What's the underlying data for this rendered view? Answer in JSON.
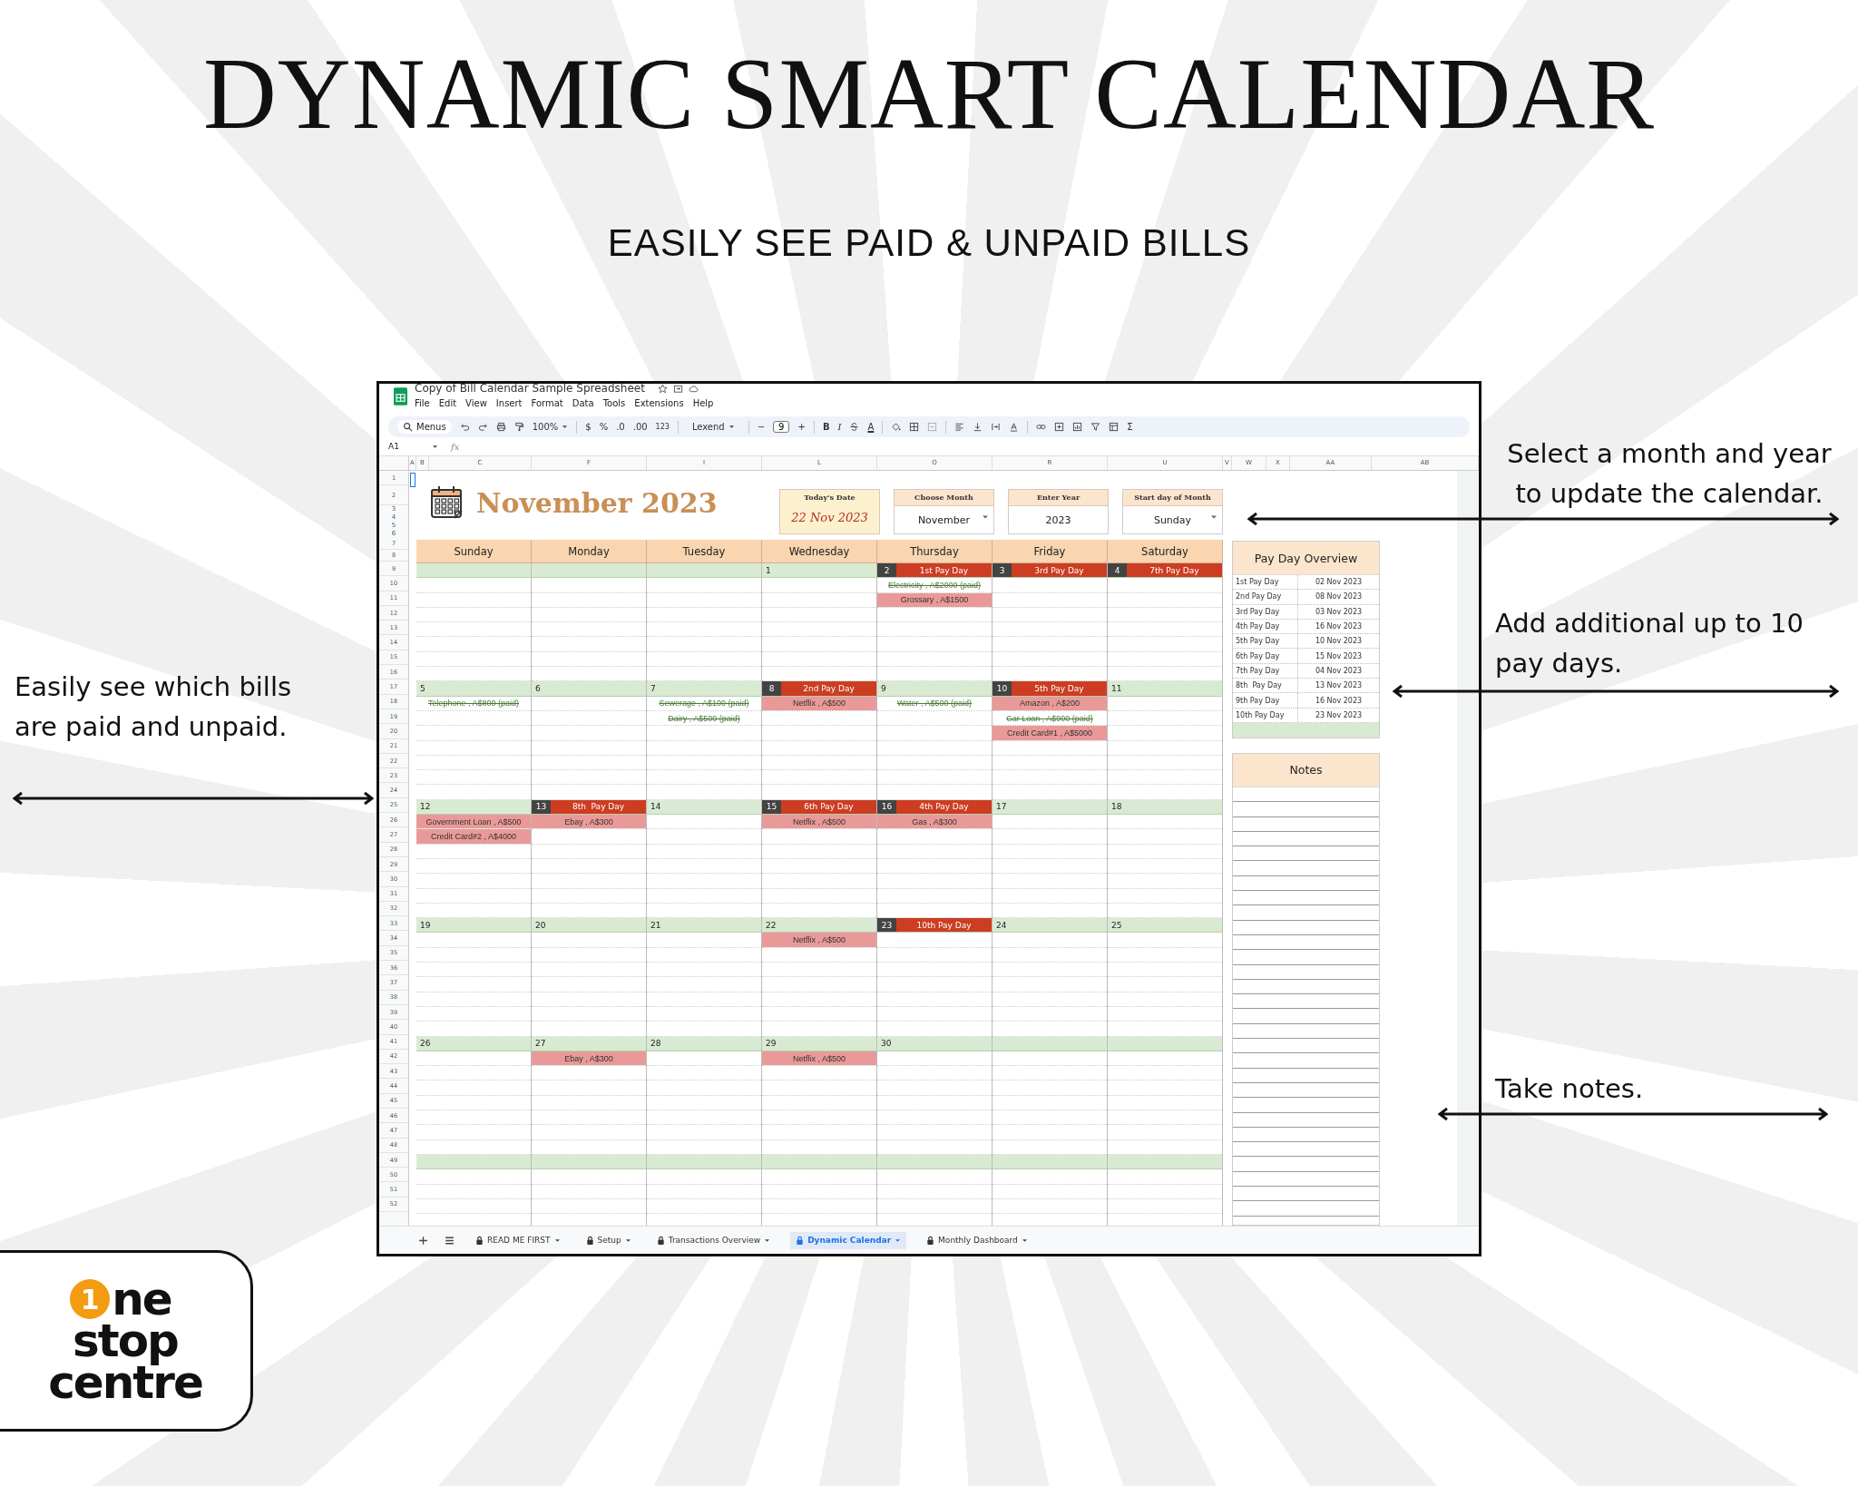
{
  "title": "DYNAMIC SMART CALENDAR",
  "subtitle": "EASILY SEE PAID & UNPAID BILLS",
  "annotations": [
    "Select a month and year to update the calendar.",
    "Add additional up to 10 pay days.",
    "Easily see which bills are paid and unpaid.",
    "Take notes."
  ],
  "sheet": {
    "doc_title": "Copy of Bill Calendar Sample Spreadsheet",
    "menus": [
      "File",
      "Edit",
      "View",
      "Insert",
      "Format",
      "Data",
      "Tools",
      "Extensions",
      "Help"
    ],
    "toolbar": {
      "search": "Menus",
      "zoom": "100%",
      "currency": "$",
      "percent": "%",
      "decrease_decimals": ".0",
      "increase_decimals": ".00",
      "number_format": "123",
      "font": "Lexend",
      "decrease_size": "−",
      "font_size": "9",
      "increase_size": "+",
      "bold": "B",
      "italic": "I",
      "text_color": "A",
      "functions": "Σ"
    },
    "cell_ref": "A1",
    "fx": "fx",
    "columns": [
      "A",
      "B",
      "C",
      "F",
      "I",
      "L",
      "O",
      "R",
      "U",
      "V",
      "W",
      "X",
      "AA",
      "AB"
    ],
    "row_numbers": [
      "1",
      "2",
      "3",
      "4",
      "5",
      "6",
      "7",
      "8",
      "9",
      "10",
      "11",
      "12",
      "13",
      "14",
      "15",
      "16",
      "17",
      "18",
      "19",
      "20",
      "21",
      "22",
      "23",
      "24",
      "25",
      "26",
      "27",
      "28",
      "29",
      "30",
      "31",
      "32",
      "33",
      "34",
      "35",
      "36",
      "37",
      "38",
      "39",
      "40",
      "41",
      "42",
      "43",
      "44",
      "45",
      "46",
      "47",
      "48",
      "49",
      "50",
      "51",
      "52"
    ],
    "month_title": "November 2023",
    "controls": [
      {
        "label": "Today's Date",
        "value": "22 Nov 2023",
        "kind": "date"
      },
      {
        "label": "Choose Month",
        "value": "November",
        "kind": "dropdown"
      },
      {
        "label": "Enter Year",
        "value": "2023",
        "kind": "input"
      },
      {
        "label": "Start day of Month",
        "value": "Sunday",
        "kind": "dropdown"
      }
    ],
    "weekdays": [
      "Sunday",
      "Monday",
      "Tuesday",
      "Wednesday",
      "Thursday",
      "Friday",
      "Saturday"
    ],
    "weeks": [
      [
        {
          "kind": "blank"
        },
        {
          "kind": "blank"
        },
        {
          "kind": "blank"
        },
        {
          "date": "1"
        },
        {
          "date": "2",
          "payday": "1st Pay Day",
          "entries": [
            {
              "text": "Electricity , A$2000 (paid)",
              "paid": true
            },
            {
              "text": "Grossary , A$1500",
              "paid": false
            }
          ]
        },
        {
          "date": "3",
          "payday": "3rd Pay Day"
        },
        {
          "date": "4",
          "payday": "7th Pay Day"
        }
      ],
      [
        {
          "date": "5",
          "entries": [
            {
              "text": "Telephone , A$800 (paid)",
              "paid": true
            }
          ]
        },
        {
          "date": "6"
        },
        {
          "date": "7",
          "entries": [
            {
              "text": "Sewerage , A$100 (paid)",
              "paid": true
            },
            {
              "text": "Dairy , A$500 (paid)",
              "paid": true
            }
          ]
        },
        {
          "date": "8",
          "payday": "2nd Pay Day",
          "entries": [
            {
              "text": "Netflix , A$500",
              "paid": false
            }
          ]
        },
        {
          "date": "9",
          "entries": [
            {
              "text": "Water , A$500 (paid)",
              "paid": true
            }
          ]
        },
        {
          "date": "10",
          "payday": "5th Pay Day",
          "entries": [
            {
              "text": "Amazon , A$200",
              "paid": false
            },
            {
              "text": "Car Loan , A$900 (paid)",
              "paid": true
            },
            {
              "text": "Credit Card#1 , A$5000",
              "paid": false
            }
          ]
        },
        {
          "date": "11"
        }
      ],
      [
        {
          "date": "12",
          "entries": [
            {
              "text": "Government Loan , A$500",
              "paid": false
            },
            {
              "text": "Credit Card#2 , A$4000",
              "paid": false
            }
          ]
        },
        {
          "date": "13",
          "payday": "8th  Pay Day",
          "entries": [
            {
              "text": "Ebay , A$300",
              "paid": false
            }
          ]
        },
        {
          "date": "14"
        },
        {
          "date": "15",
          "payday": "6th Pay Day",
          "entries": [
            {
              "text": "Netflix , A$500",
              "paid": false
            }
          ]
        },
        {
          "date": "16",
          "payday": "4th Pay Day",
          "entries": [
            {
              "text": "Gas , A$300",
              "paid": false
            }
          ]
        },
        {
          "date": "17"
        },
        {
          "date": "18"
        }
      ],
      [
        {
          "date": "19"
        },
        {
          "date": "20"
        },
        {
          "date": "21"
        },
        {
          "date": "22",
          "entries": [
            {
              "text": "Netflix , A$500",
              "paid": false
            }
          ]
        },
        {
          "date": "23",
          "payday": "10th Pay Day"
        },
        {
          "date": "24"
        },
        {
          "date": "25"
        }
      ],
      [
        {
          "date": "26"
        },
        {
          "date": "27",
          "entries": [
            {
              "text": "Ebay , A$300",
              "paid": false
            }
          ]
        },
        {
          "date": "28"
        },
        {
          "date": "29",
          "entries": [
            {
              "text": "Netflix , A$500",
              "paid": false
            }
          ]
        },
        {
          "date": "30"
        },
        {
          "kind": "blank"
        },
        {
          "kind": "blank"
        }
      ],
      [
        {
          "kind": "blank"
        },
        {
          "kind": "blank"
        },
        {
          "kind": "blank"
        },
        {
          "kind": "blank"
        },
        {
          "kind": "blank"
        },
        {
          "kind": "blank"
        },
        {
          "kind": "blank"
        }
      ]
    ],
    "payday_overview": {
      "title": "Pay Day Overview",
      "rows": [
        {
          "label": "1st Pay Day",
          "date": "02 Nov 2023"
        },
        {
          "label": "2nd Pay Day",
          "date": "08 Nov 2023"
        },
        {
          "label": "3rd Pay Day",
          "date": "03 Nov 2023"
        },
        {
          "label": "4th Pay Day",
          "date": "16 Nov 2023"
        },
        {
          "label": "5th Pay Day",
          "date": "10 Nov 2023"
        },
        {
          "label": "6th Pay Day",
          "date": "15 Nov 2023"
        },
        {
          "label": "7th Pay Day",
          "date": "04 Nov 2023"
        },
        {
          "label": "8th  Pay Day",
          "date": "13 Nov 2023"
        },
        {
          "label": "9th Pay Day",
          "date": "16 Nov 2023"
        },
        {
          "label": "10th Pay Day",
          "date": "23 Nov 2023"
        }
      ]
    },
    "notes_title": "Notes",
    "tabs": [
      {
        "label": "READ ME FIRST",
        "selected": false
      },
      {
        "label": "Setup",
        "selected": false
      },
      {
        "label": "Transactions Overview",
        "selected": false
      },
      {
        "label": "Dynamic Calendar",
        "selected": true
      },
      {
        "label": "Monthly Dashboard",
        "selected": false
      }
    ]
  },
  "logo": {
    "badge": "1",
    "lines": [
      "ne",
      "stop",
      "centre"
    ]
  }
}
